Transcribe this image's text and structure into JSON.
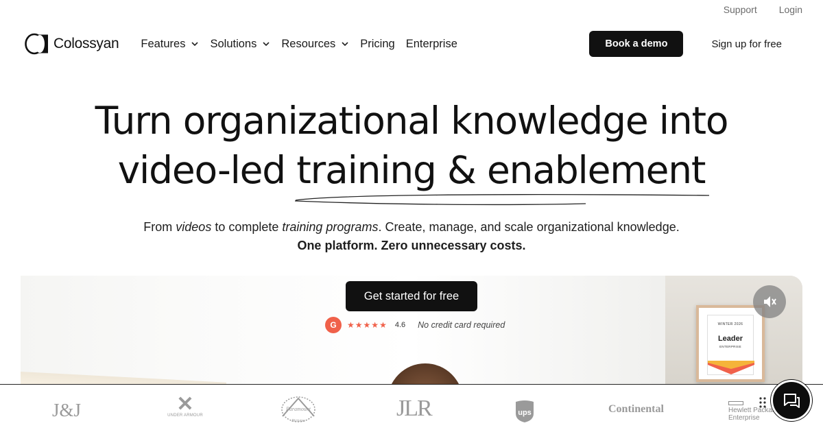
{
  "utility": {
    "support": "Support",
    "login": "Login"
  },
  "brand": {
    "name": "Colossyan"
  },
  "nav": {
    "items": [
      {
        "label": "Features",
        "has_dropdown": true
      },
      {
        "label": "Solutions",
        "has_dropdown": true
      },
      {
        "label": "Resources",
        "has_dropdown": true
      },
      {
        "label": "Pricing",
        "has_dropdown": false
      },
      {
        "label": "Enterprise",
        "has_dropdown": false
      }
    ],
    "book_demo": "Book a demo",
    "signup": "Sign up for free"
  },
  "hero": {
    "title_line1": "Turn organizational knowledge into",
    "title_line2": "video-led training & enablement",
    "sub_from": "From ",
    "sub_videos": "videos",
    "sub_to": " to complete ",
    "sub_programs": "training programs",
    "sub_rest": ". Create, manage, and scale organizational knowledge.",
    "sub_line2": "One platform. Zero unnecessary costs.",
    "cta": "Get started for free",
    "rating_score": "4.6",
    "rating_stars": 4.6,
    "no_card": "No credit card required"
  },
  "badge": {
    "season": "WINTER 2026",
    "title": "Leader",
    "segment": "ENTERPRISE"
  },
  "logos": {
    "jj": "J&J",
    "under_armour": "UNDER ARMOUR",
    "paramount_script": "Paramount",
    "paramount_sub": "Pictures",
    "jlr": "JLR",
    "ups": "ups",
    "continental": "Continental",
    "hpe_line1": "Hewlett Packard",
    "hpe_line2": "Enterprise"
  },
  "colors": {
    "accent": "#f0614a",
    "dark": "#111111",
    "muted": "#6b6b6b"
  },
  "icons": [
    "chevron-down-icon",
    "mute-icon",
    "chat-icon",
    "g2-icon",
    "star-icon",
    "drag-dots-icon"
  ]
}
